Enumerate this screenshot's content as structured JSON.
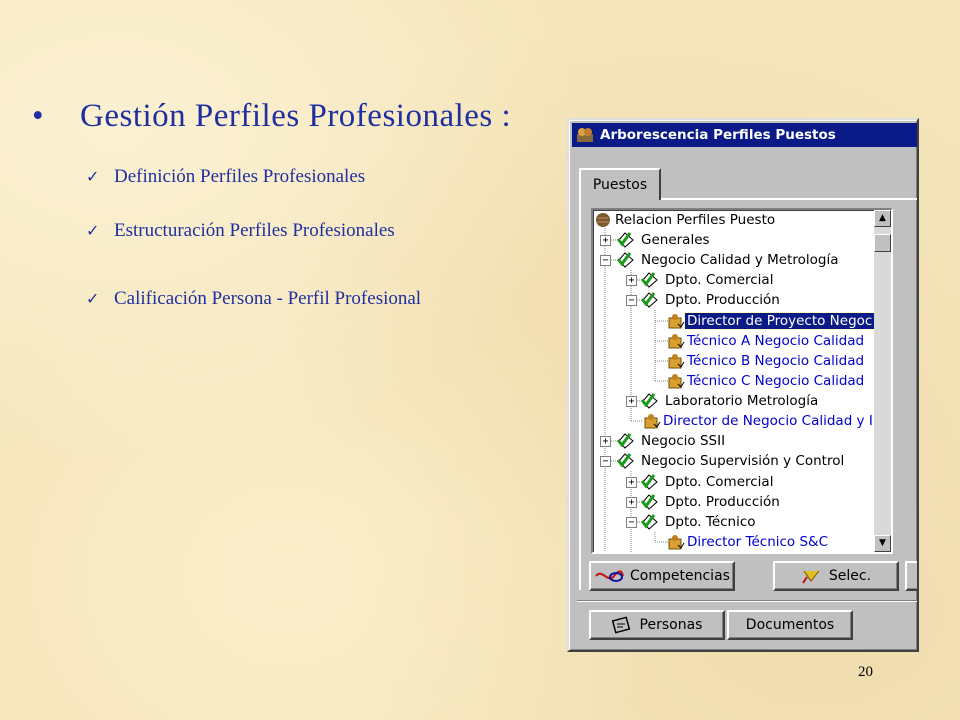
{
  "slide": {
    "title": "Gestión  Perfiles  Profesionales  :",
    "bullet": "•",
    "tick": "✓",
    "items": [
      "Definición Perfiles Profesionales",
      "Estructuración Perfiles Profesionales",
      "Calificación Persona - Perfil Profesional"
    ],
    "page_number": "20"
  },
  "window": {
    "title": "Arborescencia Perfiles Puestos",
    "tab": "Puestos",
    "tree": {
      "root": "Relacion Perfiles Puesto",
      "nodes": [
        "Generales",
        "Negocio Calidad y Metrología",
        "Dpto. Comercial",
        "Dpto. Producción",
        "Director de Proyecto Negoc",
        "Técnico A Negocio Calidad",
        "Técnico B Negocio Calidad",
        "Técnico C Negocio Calidad",
        "Laboratorio Metrología",
        "Director de Negocio Calidad y I",
        "Negocio SSII",
        "Negocio Supervisión y Control",
        "Dpto. Comercial",
        "Dpto. Producción",
        "Dpto. Técnico",
        "Director Técnico S&C"
      ]
    },
    "buttons": {
      "competencias": "Competencias",
      "selec": "Selec.",
      "personas": "Personas",
      "documentos": "Documentos"
    },
    "colors": {
      "title_bar": "#0a1a86",
      "leaf_text": "#0000cc",
      "slide_text": "#1f2fa0"
    }
  }
}
